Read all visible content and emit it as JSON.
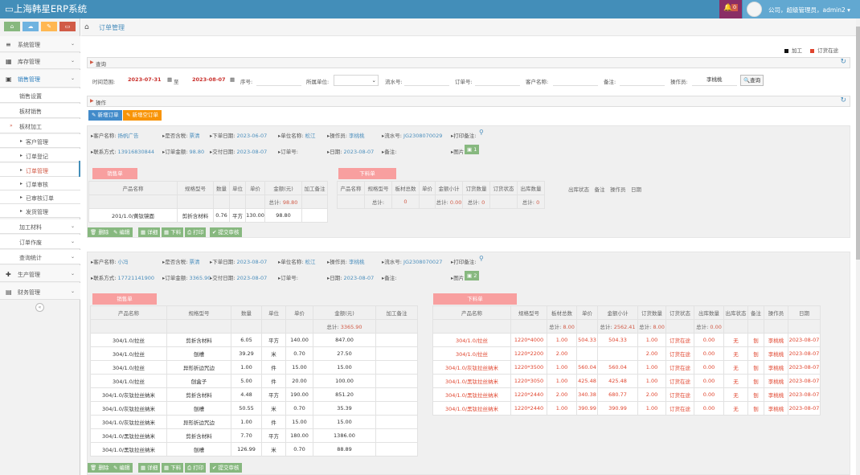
{
  "app": {
    "title": "上海韩星ERP系统",
    "notif_count": "0",
    "user": "公司，超级管理员，admin2"
  },
  "side_buttons": [
    "⌂",
    "☁",
    "✎",
    "▭"
  ],
  "sidebar": [
    {
      "label": "系统管理",
      "icon": "≡"
    },
    {
      "label": "库存管理",
      "icon": "▦"
    },
    {
      "label": "销售管理",
      "icon": "▣"
    },
    {
      "label": "销售设置",
      "icon": ""
    },
    {
      "label": "板材销售",
      "icon": ""
    },
    {
      "label": "板材加工",
      "icon": ""
    },
    {
      "label": "客户管理",
      "icon": "▸"
    },
    {
      "label": "订单登记",
      "icon": "▸"
    },
    {
      "label": "订单管理",
      "icon": "▸"
    },
    {
      "label": "订单审核",
      "icon": "▸"
    },
    {
      "label": "已审核订单",
      "icon": "▸"
    },
    {
      "label": "发货管理",
      "icon": "▸"
    },
    {
      "label": "加工材料",
      "icon": ""
    },
    {
      "label": "订单作废",
      "icon": ""
    },
    {
      "label": "查询统计",
      "icon": ""
    },
    {
      "label": "生产管理",
      "icon": "✚"
    },
    {
      "label": "财务管理",
      "icon": "▤"
    }
  ],
  "breadcrumb": "订单管理",
  "legend": {
    "a": "加工",
    "b": "订货在途"
  },
  "query": {
    "title": "查询",
    "time_label": "时间范围:",
    "date_from": "2023-07-31",
    "to": "至",
    "date_to": "2023-08-07",
    "seq": "序号:",
    "unit": "所属单位:",
    "flow": "流水号:",
    "order": "订单号:",
    "customer": "客户名称:",
    "remark": "备注:",
    "operator": "操作员:",
    "operator_value": "李桃桃",
    "search": "查询"
  },
  "ops": {
    "title": "操作",
    "new_order": "新增订单",
    "new_empty": "新增空订单"
  },
  "labels": {
    "cust": "▸客户名称:",
    "contract": "▸是否含税:",
    "orderdate": "▸下单日期:",
    "unitname": "▸单位名称:",
    "op": "▸操作员:",
    "flow": "▸流水号:",
    "print": "▸打印备注:",
    "phone": "▸联系方式:",
    "amount": "▸订单金额:",
    "delivery": "▸交付日期:",
    "orderno": "▸订单号:",
    "date": "▸日期:",
    "note": "▸备注:",
    "pic": "▸图片:",
    "sales": "销售单",
    "material": "下料单",
    "total": "总计:",
    "h1": [
      "产品名称",
      "规格型号",
      "数量",
      "单位",
      "单价",
      "金额(元)",
      "加工备注"
    ],
    "h2": [
      "产品名称",
      "规格型号",
      "板材总数",
      "单价",
      "金额小计",
      "订货数量",
      "订货状态",
      "出库数量",
      "出库状态",
      "备注",
      "操作员",
      "日期"
    ]
  },
  "actions": [
    "删除",
    "编辑",
    "详细",
    "下料",
    "打印",
    "提交审核"
  ],
  "orders": [
    {
      "customer": "扬帆广告",
      "tax": "票清",
      "order_date": "2023-06-07",
      "unit": "松江",
      "operator": "李桃桃",
      "flow": "JG2308070029",
      "phone": "13916830844",
      "amount": "98.80",
      "delivery": "2023-08-07",
      "date": "2023-08-07",
      "pics": "1",
      "sales_total": "98.80",
      "mat_total": "0",
      "mat_sub": "0.00",
      "mat_qty": "0",
      "mat_out": "0",
      "sales_rows": [
        [
          "201/1.0/黄钛镜面",
          "剪折含材料",
          "0.76",
          "平方",
          "130.00",
          "98.80",
          ""
        ]
      ],
      "mat_rows": []
    },
    {
      "customer": "小冯",
      "tax": "票清",
      "order_date": "2023-08-07",
      "unit": "松江",
      "operator": "李桃桃",
      "flow": "JG2308070027",
      "phone": "17721141900",
      "amount": "3365.90",
      "delivery": "2023-08-07",
      "date": "2023-08-07",
      "pics": "2",
      "sales_total": "3365.90",
      "mat_total": "8.00",
      "mat_sub": "2562.41",
      "mat_qty": "8.00",
      "mat_out": "0.00",
      "sales_rows": [
        [
          "304/1.0/拉丝",
          "剪折含材料",
          "6.05",
          "平方",
          "140.00",
          "847.00",
          ""
        ],
        [
          "304/1.0/拉丝",
          "刨槽",
          "39.29",
          "米",
          "0.70",
          "27.50",
          ""
        ],
        [
          "304/1.0/拉丝",
          "异形折边咒边",
          "1.00",
          "件",
          "15.00",
          "15.00",
          ""
        ],
        [
          "304/1.0/拉丝",
          "刨盒子",
          "5.00",
          "件",
          "20.00",
          "100.00",
          ""
        ],
        [
          "304/1.0/灰钛拉丝纳米",
          "剪折含材料",
          "4.48",
          "平方",
          "190.00",
          "851.20",
          ""
        ],
        [
          "304/1.0/灰钛拉丝纳米",
          "刨槽",
          "50.55",
          "米",
          "0.70",
          "35.39",
          ""
        ],
        [
          "304/1.0/灰钛拉丝纳米",
          "异形折边咒边",
          "1.00",
          "件",
          "15.00",
          "15.00",
          ""
        ],
        [
          "304/1.0/黑钛拉丝纳米",
          "剪折含材料",
          "7.70",
          "平方",
          "180.00",
          "1386.00",
          ""
        ],
        [
          "304/1.0/黑钛拉丝纳米",
          "刨槽",
          "126.99",
          "米",
          "0.70",
          "88.89",
          ""
        ]
      ],
      "mat_rows": [
        [
          "304/1.0/拉丝",
          "1220*4000",
          "1.00",
          "504.33",
          "504.33",
          "1.00",
          "订货在途",
          "0.00",
          "无",
          "刨",
          "李桃桃",
          "2023-08-07"
        ],
        [
          "304/1.0/拉丝",
          "1220*2200",
          "2.00",
          "",
          "",
          "2.00",
          "订货在途",
          "0.00",
          "无",
          "刨",
          "李桃桃",
          "2023-08-07"
        ],
        [
          "304/1.0/灰钛拉丝纳米",
          "1220*3500",
          "1.00",
          "560.04",
          "560.04",
          "1.00",
          "订货在途",
          "0.00",
          "无",
          "刨",
          "李桃桃",
          "2023-08-07"
        ],
        [
          "304/1.0/黑钛拉丝纳米",
          "1220*3050",
          "1.00",
          "425.48",
          "425.48",
          "1.00",
          "订货在途",
          "0.00",
          "无",
          "刨",
          "李桃桃",
          "2023-08-07"
        ],
        [
          "304/1.0/黑钛拉丝纳米",
          "1220*2440",
          "2.00",
          "340.38",
          "680.77",
          "2.00",
          "订货在途",
          "0.00",
          "无",
          "刨",
          "李桃桃",
          "2023-08-07"
        ],
        [
          "304/1.0/黑钛拉丝纳米",
          "1220*2440",
          "1.00",
          "390.99",
          "390.99",
          "1.00",
          "订货在途",
          "0.00",
          "无",
          "刨",
          "李桃桃",
          "2023-08-07"
        ]
      ]
    }
  ]
}
